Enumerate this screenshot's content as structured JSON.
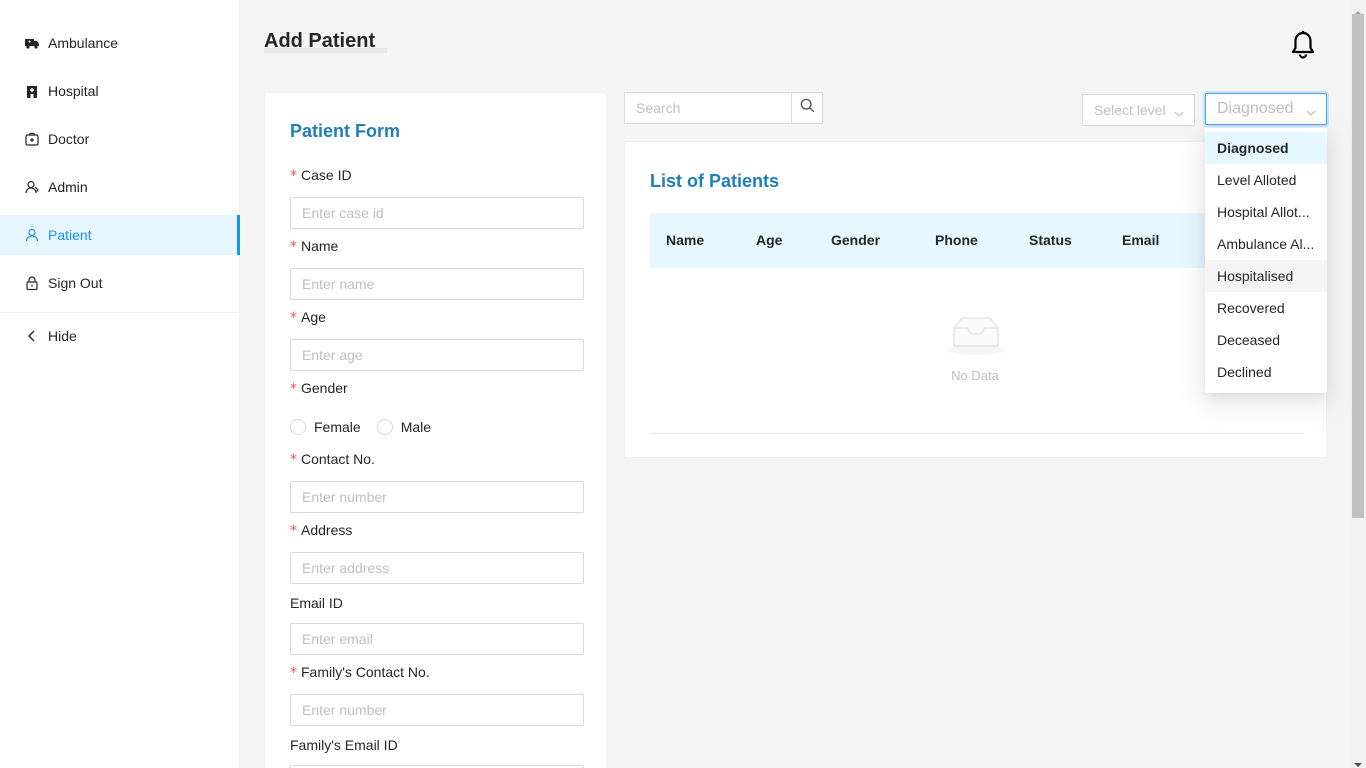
{
  "sidebar": {
    "items": [
      {
        "label": "Ambulance",
        "icon": "ambulance-icon"
      },
      {
        "label": "Hospital",
        "icon": "hospital-icon"
      },
      {
        "label": "Doctor",
        "icon": "doctor-icon"
      },
      {
        "label": "Admin",
        "icon": "admin-icon"
      },
      {
        "label": "Patient",
        "icon": "patient-icon",
        "active": true
      },
      {
        "label": "Sign Out",
        "icon": "lock-icon"
      }
    ],
    "hide_label": "Hide"
  },
  "header": {
    "title": "Add Patient",
    "notification_icon": "bell-icon"
  },
  "form": {
    "title": "Patient Form",
    "case_id": {
      "label": "Case ID",
      "placeholder": "Enter case id",
      "required": true
    },
    "name": {
      "label": "Name",
      "placeholder": "Enter name",
      "required": true
    },
    "age": {
      "label": "Age",
      "placeholder": "Enter age",
      "required": true
    },
    "gender": {
      "label": "Gender",
      "required": true,
      "options": [
        "Female",
        "Male"
      ]
    },
    "contact": {
      "label": "Contact No.",
      "placeholder": "Enter number",
      "required": true
    },
    "address": {
      "label": "Address",
      "placeholder": "Enter address",
      "required": true
    },
    "email": {
      "label": "Email ID",
      "placeholder": "Enter email",
      "required": false
    },
    "family_contact": {
      "label": "Family's Contact No.",
      "placeholder": "Enter number",
      "required": true
    },
    "family_email": {
      "label": "Family's Email ID",
      "required": false
    },
    "required_mark": "*"
  },
  "toolbar": {
    "search_placeholder": "Search",
    "level_placeholder": "Select level",
    "status_value": "Diagnosed"
  },
  "list": {
    "title": "List of Patients",
    "columns": [
      "Name",
      "Age",
      "Gender",
      "Phone",
      "Status",
      "Email"
    ],
    "empty_text": "No Data"
  },
  "status_dropdown": {
    "options": [
      "Diagnosed",
      "Level Alloted",
      "Hospital Allot...",
      "Ambulance Al...",
      "Hospitalised",
      "Recovered",
      "Deceased",
      "Declined"
    ],
    "selected_index": 0,
    "hover_index": 4
  },
  "colors": {
    "accent": "#1890ff",
    "title_blue": "#1f7fb8",
    "required_red": "#ff4d4f",
    "header_bg": "#e6f7ff"
  }
}
